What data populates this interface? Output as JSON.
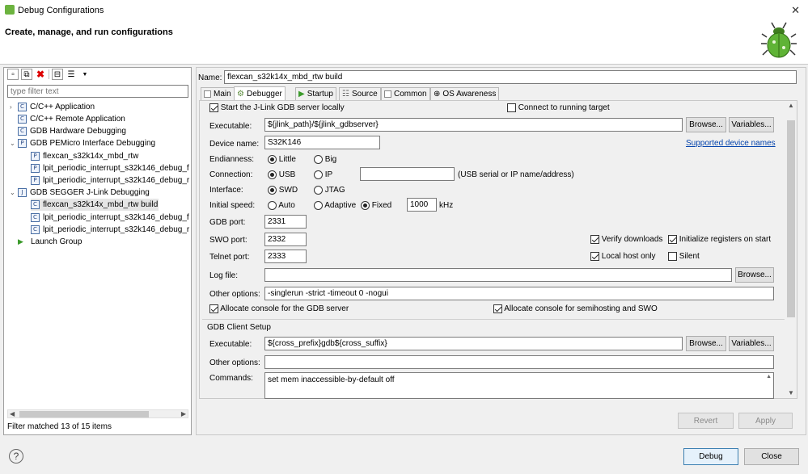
{
  "window": {
    "title": "Debug Configurations",
    "close_glyph": "✕"
  },
  "header": {
    "subtitle": "Create, manage, and run configurations"
  },
  "left": {
    "filter_placeholder": "type filter text",
    "tree": [
      {
        "label": "C/C++ Application",
        "icon": "C",
        "arrow": "›"
      },
      {
        "label": "C/C++ Remote Application",
        "icon": "C",
        "arrow": ""
      },
      {
        "label": "GDB Hardware Debugging",
        "icon": "C",
        "arrow": ""
      },
      {
        "label": "GDB PEMicro Interface Debugging",
        "icon": "P",
        "arrow": "⌄"
      },
      {
        "label": "flexcan_s32k14x_mbd_rtw",
        "icon": "P",
        "arrow": ""
      },
      {
        "label": "lpit_periodic_interrupt_s32k146_debug_f",
        "icon": "P",
        "arrow": ""
      },
      {
        "label": "lpit_periodic_interrupt_s32k146_debug_r",
        "icon": "P",
        "arrow": ""
      },
      {
        "label": "GDB SEGGER J-Link Debugging",
        "icon": "J",
        "arrow": "⌄"
      },
      {
        "label": "flexcan_s32k14x_mbd_rtw build",
        "icon": "C",
        "arrow": ""
      },
      {
        "label": "lpit_periodic_interrupt_s32k146_debug_f",
        "icon": "C",
        "arrow": ""
      },
      {
        "label": "lpit_periodic_interrupt_s32k146_debug_r",
        "icon": "C",
        "arrow": ""
      },
      {
        "label": "Launch Group",
        "icon": "▶",
        "arrow": ""
      }
    ],
    "status": "Filter matched 13 of 15 items"
  },
  "config": {
    "name_label": "Name:",
    "name_value": "flexcan_s32k14x_mbd_rtw build",
    "tabs": [
      "Main",
      "Debugger",
      "Startup",
      "Source",
      "Common",
      "OS Awareness"
    ]
  },
  "debugger": {
    "start_server": "Start the J-Link GDB server locally",
    "connect_running": "Connect to running target",
    "executable_label": "Executable:",
    "executable_value": "${jlink_path}/${jlink_gdbserver}",
    "browse": "Browse...",
    "variables": "Variables...",
    "device_label": "Device name:",
    "device_value": "S32K146",
    "supported_link": "Supported device names",
    "endianness_label": "Endianness:",
    "little": "Little",
    "big": "Big",
    "connection_label": "Connection:",
    "usb": "USB",
    "ip": "IP",
    "ip_hint": "(USB serial or IP name/address)",
    "interface_label": "Interface:",
    "swd": "SWD",
    "jtag": "JTAG",
    "speed_label": "Initial speed:",
    "auto": "Auto",
    "adaptive": "Adaptive",
    "fixed": "Fixed",
    "speed_value": "1000",
    "khz": "kHz",
    "gdb_port_label": "GDB port:",
    "gdb_port": "2331",
    "swo_port_label": "SWO port:",
    "swo_port": "2332",
    "telnet_port_label": "Telnet port:",
    "telnet_port": "2333",
    "verify": "Verify downloads",
    "init_regs": "Initialize registers on start",
    "local_host": "Local host only",
    "silent": "Silent",
    "log_label": "Log file:",
    "log_value": "",
    "other_label": "Other options:",
    "other_value": "-singlerun -strict -timeout 0 -nogui",
    "alloc_gdb": "Allocate console for the GDB server",
    "alloc_semi": "Allocate console for semihosting and SWO"
  },
  "client": {
    "section": "GDB Client Setup",
    "executable_label": "Executable:",
    "executable_value": "${cross_prefix}gdb${cross_suffix}",
    "other_label": "Other options:",
    "other_value": "",
    "commands_label": "Commands:",
    "commands_value": "set mem inaccessible-by-default off"
  },
  "buttons": {
    "revert": "Revert",
    "apply": "Apply",
    "debug": "Debug",
    "close": "Close",
    "help": "?"
  }
}
